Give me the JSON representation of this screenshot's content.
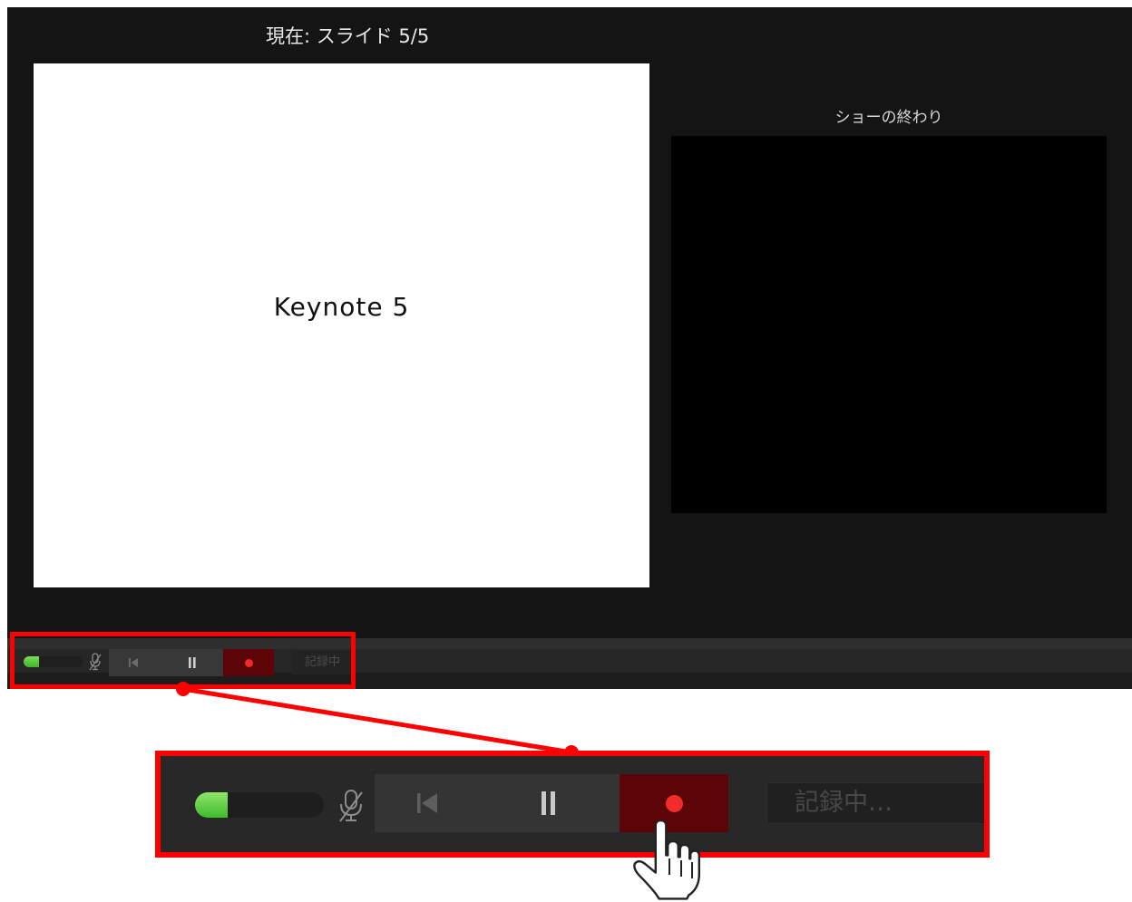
{
  "window": {
    "current_slide_label": "現在: スライド 5/5",
    "current_slide_text": "Keynote 5",
    "next_slide_label": "ショーの終わり"
  },
  "toolbar": {
    "audio_level": 0.25,
    "mic_icon": "mic-muted-icon",
    "prev_icon": "skip-back-icon",
    "pause_icon": "pause-icon",
    "record_icon": "record-icon",
    "status_text": "記録中…",
    "status_text_small": "記録中"
  },
  "annotation": {
    "cursor_icon": "hand-pointer-icon",
    "highlight_color": "#ff0000"
  },
  "colors": {
    "record_bg": "#5c0408",
    "record_dot": "#f02a2a",
    "level_green": "#4fc834"
  }
}
